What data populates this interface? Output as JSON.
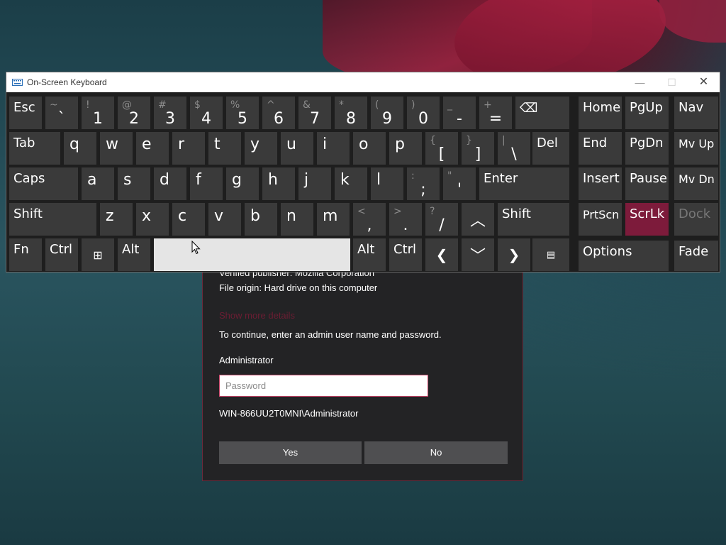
{
  "window": {
    "title": "On-Screen Keyboard",
    "controls": {
      "minimize": "—",
      "maximize": "☐",
      "close": "✕"
    }
  },
  "keyboard": {
    "row1": [
      {
        "shift": "~",
        "main": "`"
      },
      {
        "shift": "!",
        "main": "1"
      },
      {
        "shift": "@",
        "main": "2"
      },
      {
        "shift": "#",
        "main": "3"
      },
      {
        "shift": "$",
        "main": "4"
      },
      {
        "shift": "%",
        "main": "5"
      },
      {
        "shift": "^",
        "main": "6"
      },
      {
        "shift": "&",
        "main": "7"
      },
      {
        "shift": "*",
        "main": "8"
      },
      {
        "shift": "(",
        "main": "9"
      },
      {
        "shift": ")",
        "main": "0"
      },
      {
        "shift": "_",
        "main": "-"
      },
      {
        "shift": "+",
        "main": "="
      }
    ],
    "esc": "Esc",
    "backspace_icon": "backspace-icon",
    "row2_letters": [
      "q",
      "w",
      "e",
      "r",
      "t",
      "y",
      "u",
      "i",
      "o",
      "p"
    ],
    "tab": "Tab",
    "row2_punct": [
      {
        "shift": "{",
        "main": "["
      },
      {
        "shift": "}",
        "main": "]"
      },
      {
        "shift": "|",
        "main": "\\"
      }
    ],
    "del": "Del",
    "caps": "Caps",
    "row3_letters": [
      "a",
      "s",
      "d",
      "f",
      "g",
      "h",
      "j",
      "k",
      "l"
    ],
    "row3_punct": [
      {
        "shift": ":",
        "main": ";"
      },
      {
        "shift": "\"",
        "main": "'"
      }
    ],
    "enter": "Enter",
    "shift": "Shift",
    "row4_letters": [
      "z",
      "x",
      "c",
      "v",
      "b",
      "n",
      "m"
    ],
    "row4_punct": [
      {
        "shift": "<",
        "main": ","
      },
      {
        "shift": ">",
        "main": "."
      },
      {
        "shift": "?",
        "main": "/"
      }
    ],
    "fn": "Fn",
    "ctrl": "Ctrl",
    "alt": "Alt",
    "nav": {
      "home": "Home",
      "pgup": "PgUp",
      "navkey": "Nav",
      "end": "End",
      "pgdn": "PgDn",
      "mvup": "Mv Up",
      "insert": "Insert",
      "pause": "Pause",
      "mvdn": "Mv Dn",
      "prtscn": "PrtScn",
      "scrlk": "ScrLk",
      "dock": "Dock",
      "options": "Options",
      "fade": "Fade"
    },
    "active_color": "#7d1b3b"
  },
  "uac": {
    "publisher": "Verified publisher: Mozilla Corporation",
    "origin": "File origin: Hard drive on this computer",
    "details_link": "Show more details",
    "continue_text": "To continue, enter an admin user name and password.",
    "user": "Administrator",
    "password_placeholder": "Password",
    "account": "WIN-866UU2T0MNI\\Administrator",
    "yes": "Yes",
    "no": "No"
  }
}
